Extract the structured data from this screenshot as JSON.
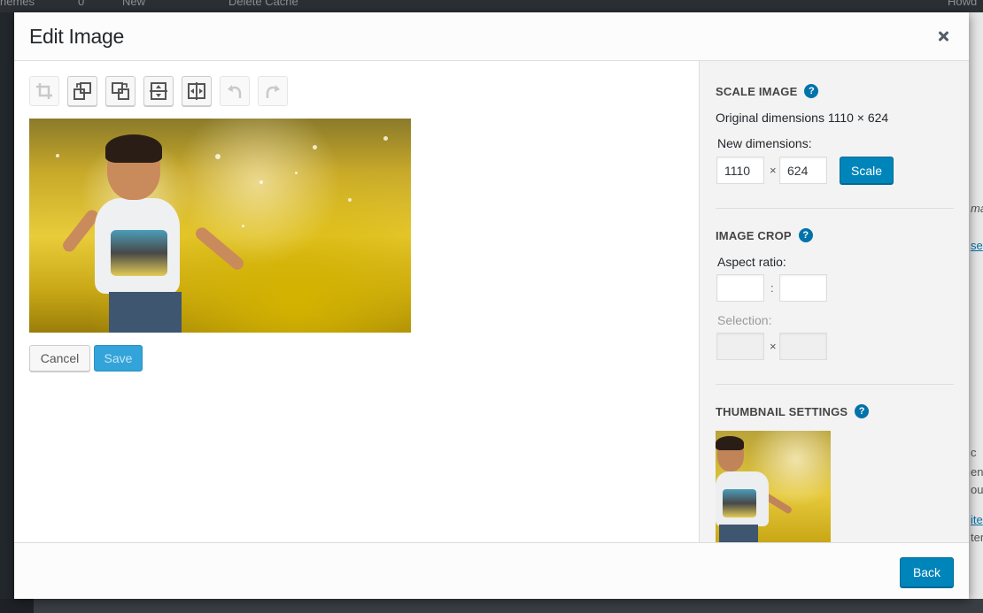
{
  "background": {
    "adminbar_items": [
      "hemes",
      "0",
      "New",
      "Delete Cache",
      "Howd"
    ],
    "right_edge_texts": [
      "ma",
      "se",
      "c",
      "en",
      "ou",
      "ite",
      "ter"
    ]
  },
  "modal": {
    "title": "Edit Image",
    "close_icon": "close-icon"
  },
  "toolbar": {
    "buttons": [
      {
        "name": "crop",
        "icon": "crop-icon",
        "enabled": false
      },
      {
        "name": "rotate-left",
        "icon": "rotate-left-icon",
        "enabled": true
      },
      {
        "name": "rotate-right",
        "icon": "rotate-right-icon",
        "enabled": true
      },
      {
        "name": "flip-vertical",
        "icon": "flip-vertical-icon",
        "enabled": true
      },
      {
        "name": "flip-horizontal",
        "icon": "flip-horizontal-icon",
        "enabled": true
      },
      {
        "name": "undo",
        "icon": "undo-icon",
        "enabled": false
      },
      {
        "name": "redo",
        "icon": "redo-icon",
        "enabled": false
      }
    ]
  },
  "actions": {
    "cancel_label": "Cancel",
    "save_label": "Save"
  },
  "scale_image": {
    "title": "SCALE IMAGE",
    "help": "?",
    "original_dimensions": "Original dimensions 1110 × 624",
    "new_dimensions_label": "New dimensions:",
    "width_value": "1110",
    "height_value": "624",
    "times": "×",
    "scale_label": "Scale"
  },
  "image_crop": {
    "title": "IMAGE CROP",
    "help": "?",
    "aspect_ratio_label": "Aspect ratio:",
    "aspect_width": "",
    "aspect_height": "",
    "colon": ":",
    "selection_label": "Selection:",
    "selection_width": "",
    "selection_height": "",
    "times": "×"
  },
  "thumbnail_settings": {
    "title": "THUMBNAIL SETTINGS",
    "help": "?"
  },
  "footer": {
    "back_label": "Back"
  },
  "colors": {
    "primary": "#0085ba",
    "help_icon": "#0073aa",
    "save_disabled": "#33a4da"
  }
}
